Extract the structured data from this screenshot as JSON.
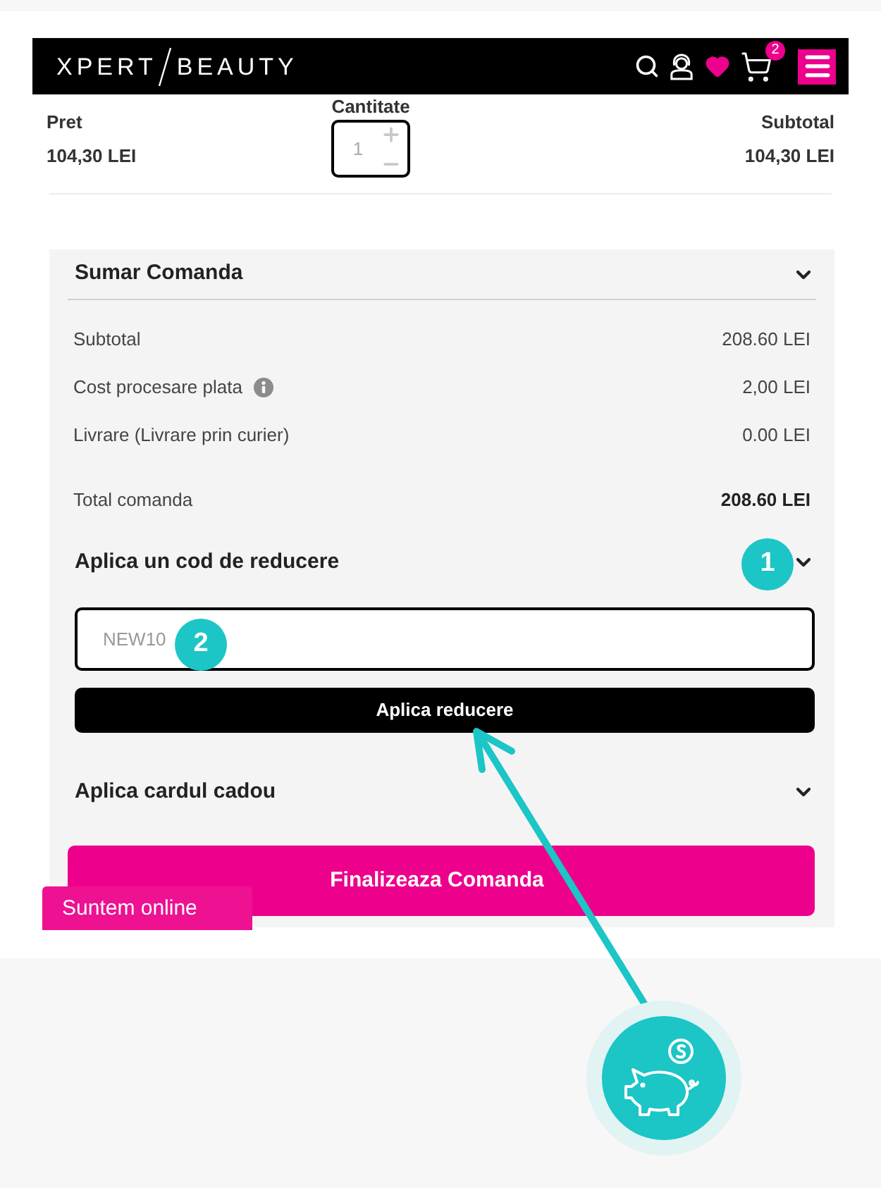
{
  "header": {
    "logo": [
      "XPERT",
      "BEAUTY"
    ],
    "cart_count": "2"
  },
  "product_row": {
    "price_label": "Pret",
    "price": "104,30 LEI",
    "quantity_label": "Cantitate",
    "quantity": "1",
    "subtotal_label": "Subtotal",
    "subtotal": "104,30 LEI"
  },
  "summary": {
    "title": "Sumar Comanda",
    "rows": [
      {
        "label": "Subtotal",
        "value": "208.60 LEI",
        "info": false
      },
      {
        "label": "Cost procesare plata",
        "value": "2,00 LEI",
        "info": true
      },
      {
        "label": "Livrare (Livrare prin curier)",
        "value": "0.00 LEI",
        "info": false
      }
    ],
    "total": {
      "label": "Total comanda",
      "value": "208.60 LEI"
    }
  },
  "discount": {
    "title": "Aplica un cod de reducere",
    "placeholder": "NEW10",
    "button": "Aplica reducere"
  },
  "gift_card": {
    "title": "Aplica cardul cadou"
  },
  "checkout_button": "Finalizeaza Comanda",
  "chat_tab": "Suntem online",
  "annotations": [
    {
      "label": "1"
    },
    {
      "label": "2"
    }
  ]
}
